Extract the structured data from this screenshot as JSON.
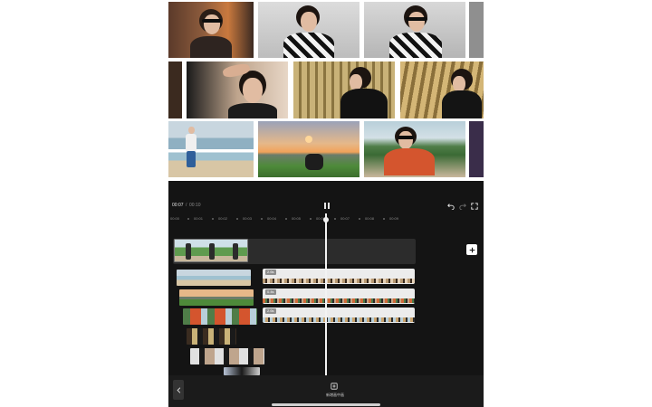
{
  "player": {
    "current_time": "00:07",
    "separator": "/",
    "total_time": "00:10"
  },
  "ruler": {
    "ticks": [
      "00:00",
      "00:01",
      "00:02",
      "00:03",
      "00:04",
      "00:05",
      "00:06",
      "00:07",
      "00:08",
      "00:09"
    ]
  },
  "tracks": {
    "clip_1_label": "2.6s",
    "clip_2_label": "0.4s",
    "clip_3_label": "2.6s"
  },
  "bottom": {
    "new_clip_label": "新增画中画"
  },
  "colors": {
    "app_bg": "#141414",
    "accent": "#ffffff"
  },
  "icons": [
    "back-icon",
    "pause-icon",
    "undo-icon",
    "redo-icon",
    "fullscreen-icon",
    "add-icon",
    "add-clip-icon"
  ]
}
